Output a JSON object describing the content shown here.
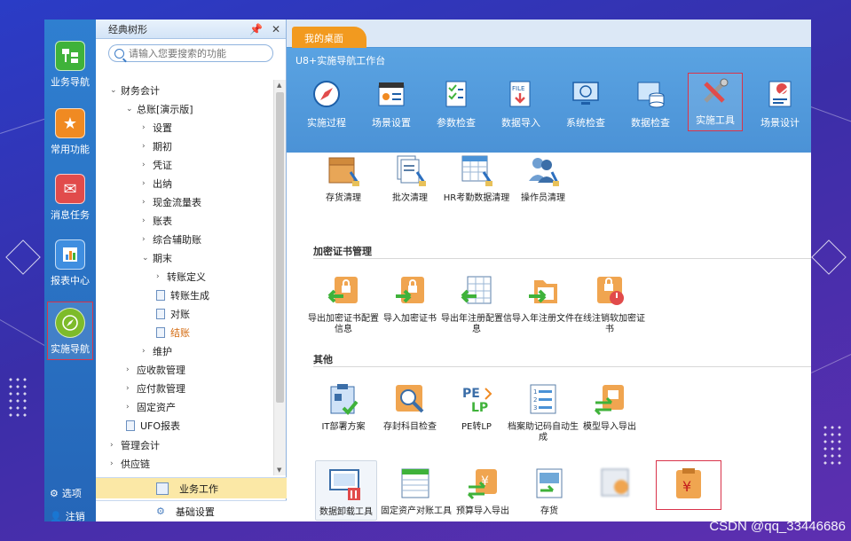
{
  "left_nav": {
    "items": [
      {
        "label": "业务导航",
        "icon": "business-nav-icon"
      },
      {
        "label": "常用功能",
        "icon": "star-icon"
      },
      {
        "label": "消息任务",
        "icon": "mail-icon"
      },
      {
        "label": "报表中心",
        "icon": "report-icon"
      },
      {
        "label": "实施导航",
        "icon": "compass-icon"
      }
    ],
    "options_label": "选项",
    "logout_label": "注销"
  },
  "tree_panel": {
    "title": "经典树形",
    "search_placeholder": "请输入您要搜索的功能",
    "nodes": {
      "n0": "财务会计",
      "n1": "总账[演示版]",
      "n2": "设置",
      "n3": "期初",
      "n4": "凭证",
      "n5": "出纳",
      "n6": "现金流量表",
      "n7": "账表",
      "n8": "综合辅助账",
      "n9": "期末",
      "n10": "转账定义",
      "n11": "转账生成",
      "n12": "对账",
      "n13": "结账",
      "n14": "维护",
      "n15": "应收款管理",
      "n16": "应付款管理",
      "n17": "固定资产",
      "n18": "UFO报表",
      "n19": "管理会计",
      "n20": "供应链"
    },
    "bottom_tabs": [
      "业务工作",
      "基础设置"
    ]
  },
  "tabs": {
    "desktop": "我的桌面"
  },
  "workbench": {
    "title": "U8+实施导航工作台",
    "toolbar": [
      "实施过程",
      "场景设置",
      "参数检查",
      "数据导入",
      "系统检查",
      "数据检查",
      "实施工具",
      "场景设计"
    ]
  },
  "sections": {
    "row1": [
      "存货清理",
      "批次清理",
      "HR考勤数据清理",
      "操作员清理"
    ],
    "cert_title": "加密证书管理",
    "cert": [
      "导出加密证书配置信息",
      "导入加密证书",
      "导出年注册配置信息",
      "导入年注册文件",
      "在线注销软加密证书"
    ],
    "other_title": "其他",
    "other": [
      "IT部署方案",
      "存封科目检查",
      "PE转LP",
      "档案助记码自动生成",
      "模型导入导出"
    ],
    "bottom": [
      "数据卸载工具",
      "固定资产对账工具",
      "预算导入导出",
      "存货"
    ]
  },
  "watermark": "CSDN @qq_33446686",
  "colors": {
    "accent": "#4b92d6",
    "tab_orange": "#f29a1f",
    "highlight_red": "#d9334a",
    "nav_blue": "#2f7fd0"
  }
}
